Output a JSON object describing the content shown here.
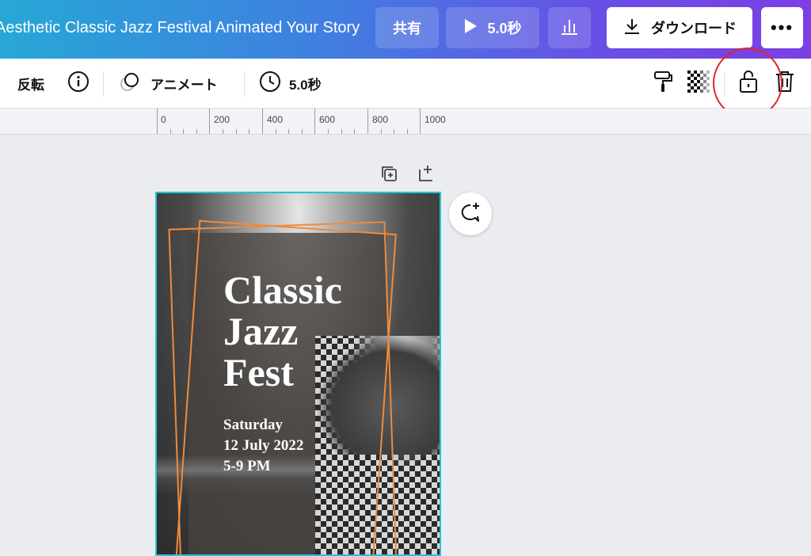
{
  "header": {
    "title": "Aesthetic Classic Jazz Festival Animated Your Story",
    "share_label": "共有",
    "play_label": "5.0秒",
    "download_label": "ダウンロード",
    "more_label": "•••"
  },
  "toolbar": {
    "flip_label": "反転",
    "animate_label": "アニメート",
    "duration_label": "5.0秒"
  },
  "ruler": {
    "ticks": [
      "0",
      "200",
      "400",
      "600",
      "800",
      "1000"
    ]
  },
  "poster": {
    "title_lines": [
      "Classic",
      "Jazz",
      "Fest"
    ],
    "day": "Saturday",
    "date": "12 July 2022",
    "time": "5-9 PM"
  },
  "colors": {
    "selection": "#22c6d8",
    "frame": "#f08a3c",
    "highlight_circle": "#e0262a"
  }
}
